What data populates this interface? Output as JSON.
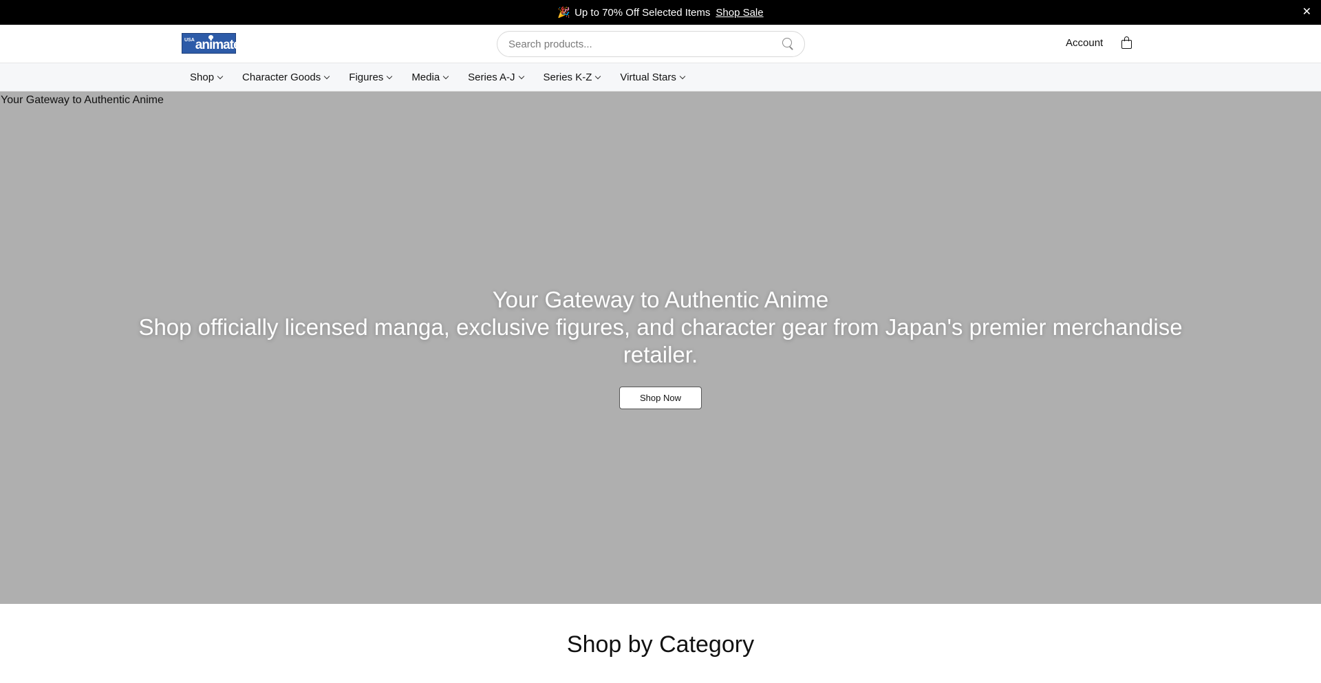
{
  "announcement": {
    "emoji": "🎉",
    "text": "Up to 70% Off Selected Items",
    "link": "Shop Sale",
    "close": "✕"
  },
  "header": {
    "logo": {
      "small": "USA",
      "word": "animate"
    },
    "search_placeholder": "Search products...",
    "account": "Account"
  },
  "nav": {
    "items": [
      {
        "label": "Shop"
      },
      {
        "label": "Character Goods"
      },
      {
        "label": "Figures"
      },
      {
        "label": "Media"
      },
      {
        "label": "Series A-J"
      },
      {
        "label": "Series K-Z"
      },
      {
        "label": "Virtual Stars"
      }
    ]
  },
  "hero": {
    "image_alt": "Your Gateway to Authentic Anime",
    "title": "Your Gateway to Authentic Anime",
    "subtitle": "Shop officially licensed manga, exclusive figures, and character gear from Japan's premier merchandise retailer.",
    "cta": "Shop Now",
    "background_color": "#afafaf"
  },
  "category": {
    "heading": "Shop by Category"
  }
}
